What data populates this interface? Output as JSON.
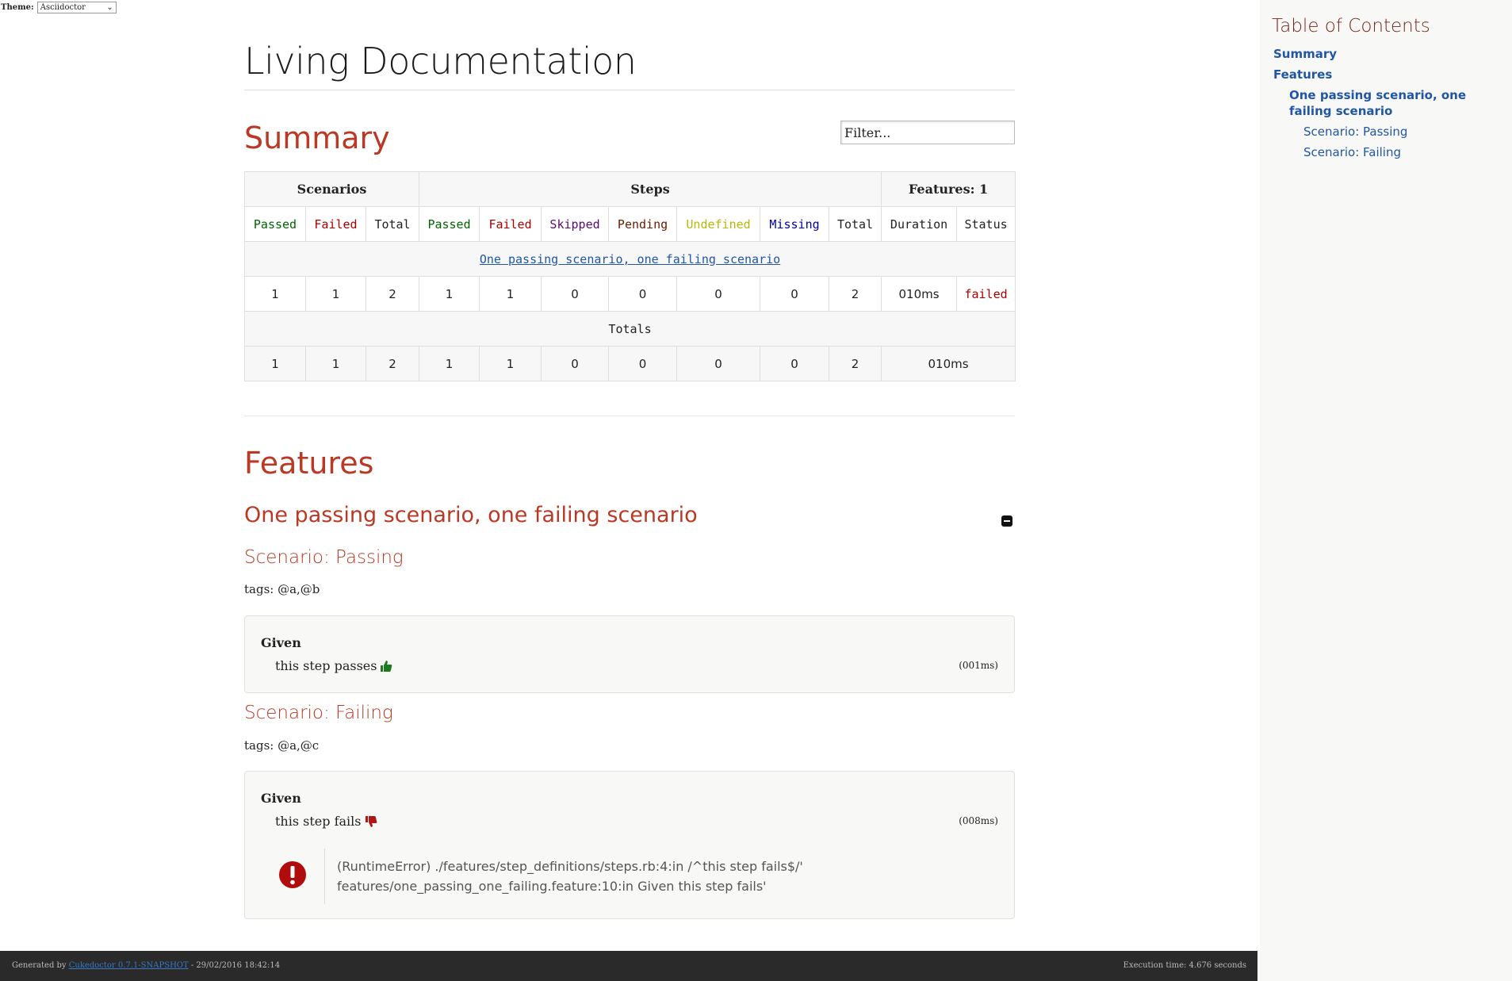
{
  "theme": {
    "label": "Theme:",
    "selected": "Asciidoctor"
  },
  "doc": {
    "title": "Living Documentation"
  },
  "summary": {
    "heading": "Summary",
    "filter_placeholder": "Filter...",
    "table": {
      "group_headers": {
        "scenarios": "Scenarios",
        "steps": "Steps",
        "features": "Features: 1"
      },
      "columns": [
        "Passed",
        "Failed",
        "Total",
        "Passed",
        "Failed",
        "Skipped",
        "Pending",
        "Undefined",
        "Missing",
        "Total",
        "Duration",
        "Status"
      ],
      "feature_link": "One passing scenario, one failing scenario",
      "feature_row": [
        "1",
        "1",
        "2",
        "1",
        "1",
        "0",
        "0",
        "0",
        "0",
        "2",
        "010ms",
        "failed"
      ],
      "totals_label": "Totals",
      "totals_row": [
        "1",
        "1",
        "2",
        "1",
        "1",
        "0",
        "0",
        "0",
        "0",
        "2",
        "010ms"
      ]
    }
  },
  "features": {
    "heading": "Features",
    "feature_title": "One passing scenario, one failing scenario",
    "scenarios": [
      {
        "title": "Scenario: Passing",
        "tags": "tags: @a,@b",
        "keyword": "Given",
        "step": "this step passes",
        "duration": "(001ms)"
      },
      {
        "title": "Scenario: Failing",
        "tags": "tags: @a,@c",
        "keyword": "Given",
        "step": "this step fails",
        "duration": "(008ms)",
        "error_line1": "(RuntimeError) ./features/step_definitions/steps.rb:4:in /^this step fails$/'",
        "error_line2": "features/one_passing_one_failing.feature:10:in Given this step fails'"
      }
    ]
  },
  "toc": {
    "title": "Table of Contents",
    "summary": "Summary",
    "features": "Features",
    "feature": "One passing scenario, one failing scenario",
    "scenario_passing": "Scenario: Passing",
    "scenario_failing": "Scenario: Failing"
  },
  "footer": {
    "generated_by": "Generated by",
    "tool": "Cukedoctor 0.7.1-SNAPSHOT",
    "date": " - 29/02/2016 18:42:14",
    "execution_time": "Execution time: 4.676 seconds"
  },
  "colors": {
    "heading": "#ba3925",
    "link": "#2156a5",
    "passed": "#006400",
    "failed": "#aa0000",
    "footer_bg": "#2a2a2a"
  }
}
